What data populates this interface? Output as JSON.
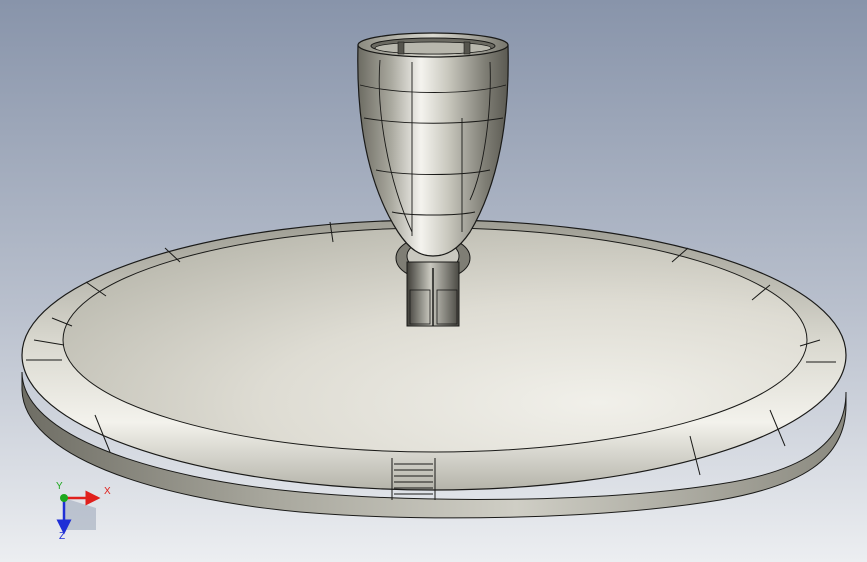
{
  "viewport": {
    "background_top": "#8a97ac",
    "background_bottom": "#e9ecf0"
  },
  "model": {
    "body_light": "#ecebe4",
    "body_mid": "#c8c7bd",
    "body_dark": "#56554d",
    "edge_color": "#1a1a18"
  },
  "triad": {
    "x_label": "X",
    "y_label": "Y",
    "z_label": "Z",
    "x_color": "#e0201c",
    "y_color": "#1ea81e",
    "z_color": "#1f2fd6"
  }
}
